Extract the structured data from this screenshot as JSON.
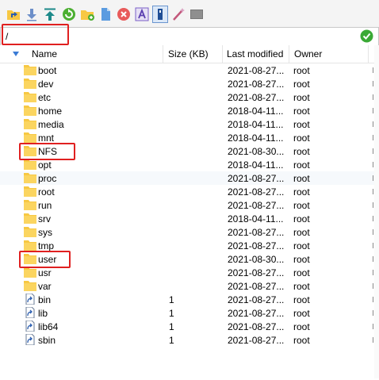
{
  "path": {
    "value": "/"
  },
  "columns": {
    "name": "Name",
    "size": "Size (KB)",
    "modified": "Last modified",
    "owner": "Owner"
  },
  "colors": {
    "folder": "#f7c843",
    "highlight": "#e02020",
    "ok": "#3aa935"
  },
  "files": [
    {
      "name": "boot",
      "size": "",
      "modified": "2021-08-27...",
      "owner": "root",
      "type": "folder"
    },
    {
      "name": "dev",
      "size": "",
      "modified": "2021-08-27...",
      "owner": "root",
      "type": "folder"
    },
    {
      "name": "etc",
      "size": "",
      "modified": "2021-08-27...",
      "owner": "root",
      "type": "folder"
    },
    {
      "name": "home",
      "size": "",
      "modified": "2018-04-11...",
      "owner": "root",
      "type": "folder"
    },
    {
      "name": "media",
      "size": "",
      "modified": "2018-04-11...",
      "owner": "root",
      "type": "folder"
    },
    {
      "name": "mnt",
      "size": "",
      "modified": "2018-04-11...",
      "owner": "root",
      "type": "folder"
    },
    {
      "name": "NFS",
      "size": "",
      "modified": "2021-08-30...",
      "owner": "root",
      "type": "folder"
    },
    {
      "name": "opt",
      "size": "",
      "modified": "2018-04-11...",
      "owner": "root",
      "type": "folder"
    },
    {
      "name": "proc",
      "size": "",
      "modified": "2021-08-27...",
      "owner": "root",
      "type": "folder"
    },
    {
      "name": "root",
      "size": "",
      "modified": "2021-08-27...",
      "owner": "root",
      "type": "folder"
    },
    {
      "name": "run",
      "size": "",
      "modified": "2021-08-27...",
      "owner": "root",
      "type": "folder"
    },
    {
      "name": "srv",
      "size": "",
      "modified": "2018-04-11...",
      "owner": "root",
      "type": "folder"
    },
    {
      "name": "sys",
      "size": "",
      "modified": "2021-08-27...",
      "owner": "root",
      "type": "folder"
    },
    {
      "name": "tmp",
      "size": "",
      "modified": "2021-08-27...",
      "owner": "root",
      "type": "folder"
    },
    {
      "name": "user",
      "size": "",
      "modified": "2021-08-30...",
      "owner": "root",
      "type": "folder"
    },
    {
      "name": "usr",
      "size": "",
      "modified": "2021-08-27...",
      "owner": "root",
      "type": "folder"
    },
    {
      "name": "var",
      "size": "",
      "modified": "2021-08-27...",
      "owner": "root",
      "type": "folder"
    },
    {
      "name": "bin",
      "size": "1",
      "modified": "2021-08-27...",
      "owner": "root",
      "type": "link"
    },
    {
      "name": "lib",
      "size": "1",
      "modified": "2021-08-27...",
      "owner": "root",
      "type": "link"
    },
    {
      "name": "lib64",
      "size": "1",
      "modified": "2021-08-27...",
      "owner": "root",
      "type": "link"
    },
    {
      "name": "sbin",
      "size": "1",
      "modified": "2021-08-27...",
      "owner": "root",
      "type": "link"
    }
  ]
}
